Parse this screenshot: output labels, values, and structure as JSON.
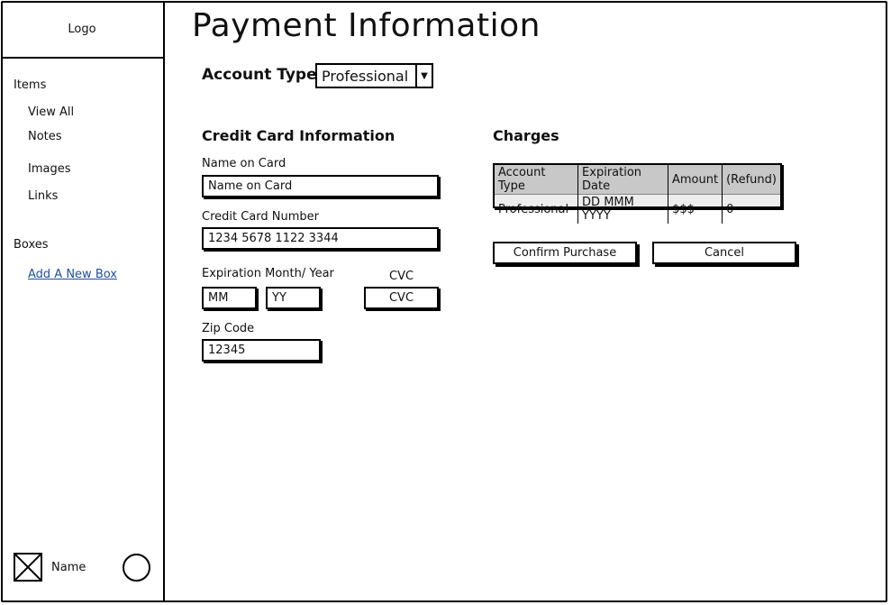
{
  "sidebar": {
    "logo": "Logo",
    "items_heading": "Items",
    "items": [
      "View All",
      "Notes",
      "Images",
      "Links"
    ],
    "boxes_heading": "Boxes",
    "add_box_link": "Add A New Box",
    "user_name": "Name"
  },
  "main": {
    "title": "Payment Information",
    "account_type_label": "Account Type:",
    "account_type_value": "Professional",
    "credit_card": {
      "heading": "Credit Card Information",
      "name_label": "Name on Card",
      "name_value": "Name on Card",
      "number_label": "Credit Card Number",
      "number_value": "1234 5678 1122 3344",
      "expiration_label": "Expiration Month/ Year",
      "month_value": "MM",
      "year_value": "YY",
      "cvc_label": "CVC",
      "cvc_value": "CVC",
      "zip_label": "Zip Code",
      "zip_value": "12345"
    },
    "charges": {
      "heading": "Charges",
      "columns": [
        "Account Type",
        "Expiration Date",
        "Amount",
        "(Refund)"
      ],
      "rows": [
        [
          "Professional",
          "DD MMM YYYY",
          "$$$",
          "0"
        ]
      ]
    },
    "confirm_label": "Confirm Purchase",
    "cancel_label": "Cancel"
  }
}
